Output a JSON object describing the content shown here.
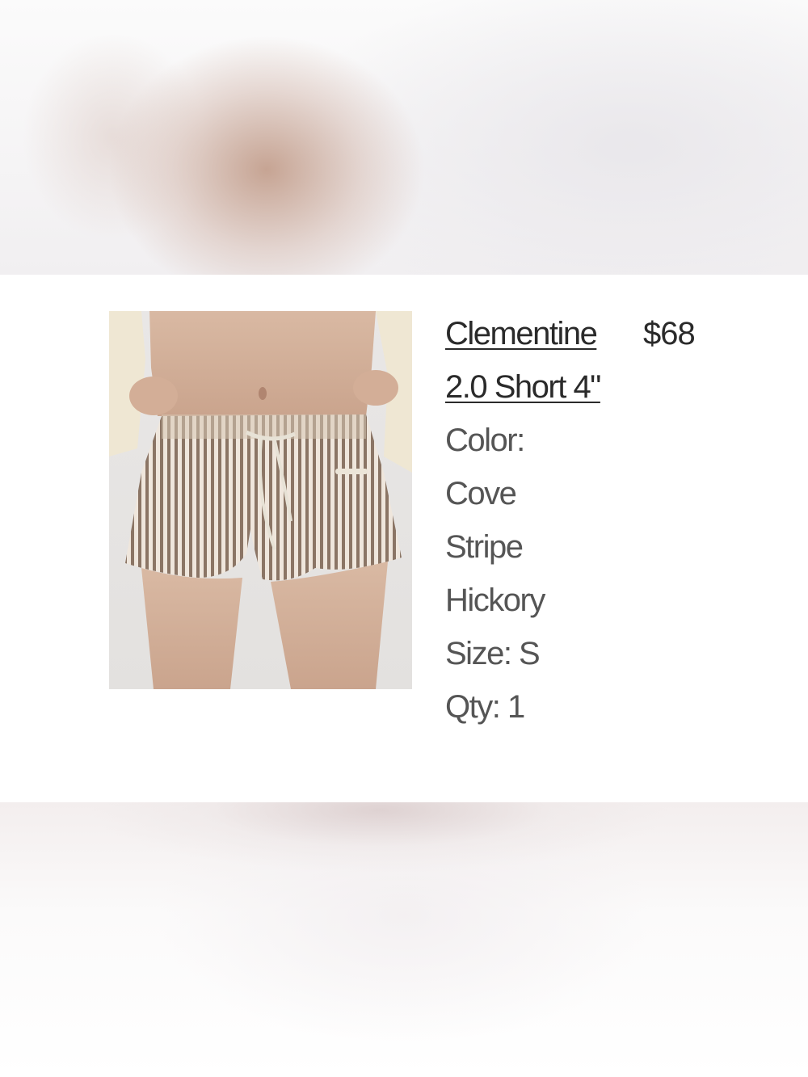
{
  "product": {
    "title": "Clementine 2.0 Short 4\"",
    "price": "$68",
    "color_label": "Color: Cove Stripe Hickory",
    "size_label": "Size: S",
    "qty_label": "Qty: 1",
    "image_icon": "product-photo-striped-shorts"
  },
  "colors": {
    "text_primary": "#2a2a2a",
    "text_secondary": "#555555",
    "stripe_dark": "#8b7565",
    "stripe_light": "#efe6dc"
  }
}
